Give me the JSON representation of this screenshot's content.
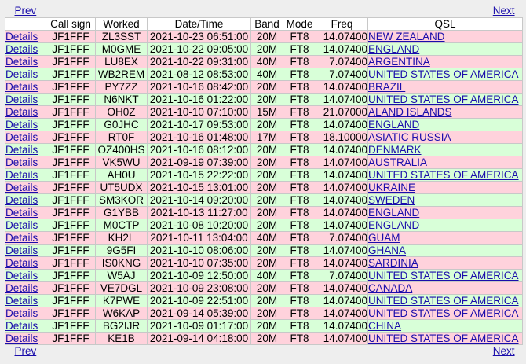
{
  "nav": {
    "prev": "Prev",
    "next": "Next"
  },
  "columns": [
    "",
    "Call sign",
    "Worked",
    "Date/Time",
    "Band",
    "Mode",
    "Freq",
    "QSL"
  ],
  "details_label": "Details",
  "rows": [
    {
      "call": "JF1FFF",
      "worked": "ZL3SST",
      "datetime": "2021-10-23 06:51:00",
      "band": "20M",
      "mode": "FT8",
      "freq": "14.07400",
      "qsl": "NEW ZEALAND",
      "color": "pink"
    },
    {
      "call": "JF1FFF",
      "worked": "M0GME",
      "datetime": "2021-10-22 09:05:00",
      "band": "20M",
      "mode": "FT8",
      "freq": "14.07400",
      "qsl": "ENGLAND",
      "color": "green"
    },
    {
      "call": "JF1FFF",
      "worked": "LU8EX",
      "datetime": "2021-10-22 09:31:00",
      "band": "40M",
      "mode": "FT8",
      "freq": "7.07400",
      "qsl": "ARGENTINA",
      "color": "pink"
    },
    {
      "call": "JF1FFF",
      "worked": "WB2REM",
      "datetime": "2021-08-12 08:53:00",
      "band": "40M",
      "mode": "FT8",
      "freq": "7.07400",
      "qsl": "UNITED STATES OF AMERICA",
      "color": "green"
    },
    {
      "call": "JF1FFF",
      "worked": "PY7ZZ",
      "datetime": "2021-10-16 08:42:00",
      "band": "20M",
      "mode": "FT8",
      "freq": "14.07400",
      "qsl": "BRAZIL",
      "color": "pink"
    },
    {
      "call": "JF1FFF",
      "worked": "N6NKT",
      "datetime": "2021-10-16 01:22:00",
      "band": "20M",
      "mode": "FT8",
      "freq": "14.07400",
      "qsl": "UNITED STATES OF AMERICA",
      "color": "green"
    },
    {
      "call": "JF1FFF",
      "worked": "OH0Z",
      "datetime": "2021-10-10 07:10:00",
      "band": "15M",
      "mode": "FT8",
      "freq": "21.07000",
      "qsl": "ALAND ISLANDS",
      "color": "pink"
    },
    {
      "call": "JF1FFF",
      "worked": "G0JHC",
      "datetime": "2021-10-17 09:53:00",
      "band": "20M",
      "mode": "FT8",
      "freq": "14.07400",
      "qsl": "ENGLAND",
      "color": "green"
    },
    {
      "call": "JF1FFF",
      "worked": "RT0F",
      "datetime": "2021-10-16 01:48:00",
      "band": "17M",
      "mode": "FT8",
      "freq": "18.10000",
      "qsl": "ASIATIC RUSSIA",
      "color": "pink"
    },
    {
      "call": "JF1FFF",
      "worked": "OZ400HS",
      "datetime": "2021-10-16 08:12:00",
      "band": "20M",
      "mode": "FT8",
      "freq": "14.07400",
      "qsl": "DENMARK",
      "color": "green"
    },
    {
      "call": "JF1FFF",
      "worked": "VK5WU",
      "datetime": "2021-09-19 07:39:00",
      "band": "20M",
      "mode": "FT8",
      "freq": "14.07400",
      "qsl": "AUSTRALIA",
      "color": "pink"
    },
    {
      "call": "JF1FFF",
      "worked": "AH0U",
      "datetime": "2021-10-15 22:22:00",
      "band": "20M",
      "mode": "FT8",
      "freq": "14.07400",
      "qsl": "UNITED STATES OF AMERICA",
      "color": "green"
    },
    {
      "call": "JF1FFF",
      "worked": "UT5UDX",
      "datetime": "2021-10-15 13:01:00",
      "band": "20M",
      "mode": "FT8",
      "freq": "14.07400",
      "qsl": "UKRAINE",
      "color": "pink"
    },
    {
      "call": "JF1FFF",
      "worked": "SM3KOR",
      "datetime": "2021-10-14 09:20:00",
      "band": "20M",
      "mode": "FT8",
      "freq": "14.07400",
      "qsl": "SWEDEN",
      "color": "green"
    },
    {
      "call": "JF1FFF",
      "worked": "G1YBB",
      "datetime": "2021-10-13 11:27:00",
      "band": "20M",
      "mode": "FT8",
      "freq": "14.07400",
      "qsl": "ENGLAND",
      "color": "pink"
    },
    {
      "call": "JF1FFF",
      "worked": "M0CTP",
      "datetime": "2021-10-08 10:20:00",
      "band": "20M",
      "mode": "FT8",
      "freq": "14.07400",
      "qsl": "ENGLAND",
      "color": "green"
    },
    {
      "call": "JF1FFF",
      "worked": "KH2L",
      "datetime": "2021-10-11 13:04:00",
      "band": "40M",
      "mode": "FT8",
      "freq": "7.07400",
      "qsl": "GUAM",
      "color": "pink"
    },
    {
      "call": "JF1FFF",
      "worked": "9G5FI",
      "datetime": "2021-10-10 08:06:00",
      "band": "20M",
      "mode": "FT8",
      "freq": "14.07400",
      "qsl": "GHANA",
      "color": "green"
    },
    {
      "call": "JF1FFF",
      "worked": "IS0KNG",
      "datetime": "2021-10-10 07:35:00",
      "band": "20M",
      "mode": "FT8",
      "freq": "14.07400",
      "qsl": "SARDINIA",
      "color": "pink"
    },
    {
      "call": "JF1FFF",
      "worked": "W5AJ",
      "datetime": "2021-10-09 12:50:00",
      "band": "40M",
      "mode": "FT8",
      "freq": "7.07400",
      "qsl": "UNITED STATES OF AMERICA",
      "color": "green"
    },
    {
      "call": "JF1FFF",
      "worked": "VE7DGL",
      "datetime": "2021-10-09 23:08:00",
      "band": "20M",
      "mode": "FT8",
      "freq": "14.07400",
      "qsl": "CANADA",
      "color": "pink"
    },
    {
      "call": "JF1FFF",
      "worked": "K7PWE",
      "datetime": "2021-10-09 22:51:00",
      "band": "20M",
      "mode": "FT8",
      "freq": "14.07400",
      "qsl": "UNITED STATES OF AMERICA",
      "color": "green"
    },
    {
      "call": "JF1FFF",
      "worked": "W6KAP",
      "datetime": "2021-09-14 05:39:00",
      "band": "20M",
      "mode": "FT8",
      "freq": "14.07400",
      "qsl": "UNITED STATES OF AMERICA",
      "color": "pink"
    },
    {
      "call": "JF1FFF",
      "worked": "BG2IJR",
      "datetime": "2021-10-09 01:17:00",
      "band": "20M",
      "mode": "FT8",
      "freq": "14.07400",
      "qsl": "CHINA",
      "color": "green"
    },
    {
      "call": "JF1FFF",
      "worked": "KE1B",
      "datetime": "2021-09-14 04:18:00",
      "band": "20M",
      "mode": "FT8",
      "freq": "14.07400",
      "qsl": "UNITED STATES OF AMERICA",
      "color": "pink"
    }
  ],
  "colors": {
    "pink_row": "#ffd2dc",
    "green_row": "#d8ffd8",
    "link": "#1a0dab"
  }
}
